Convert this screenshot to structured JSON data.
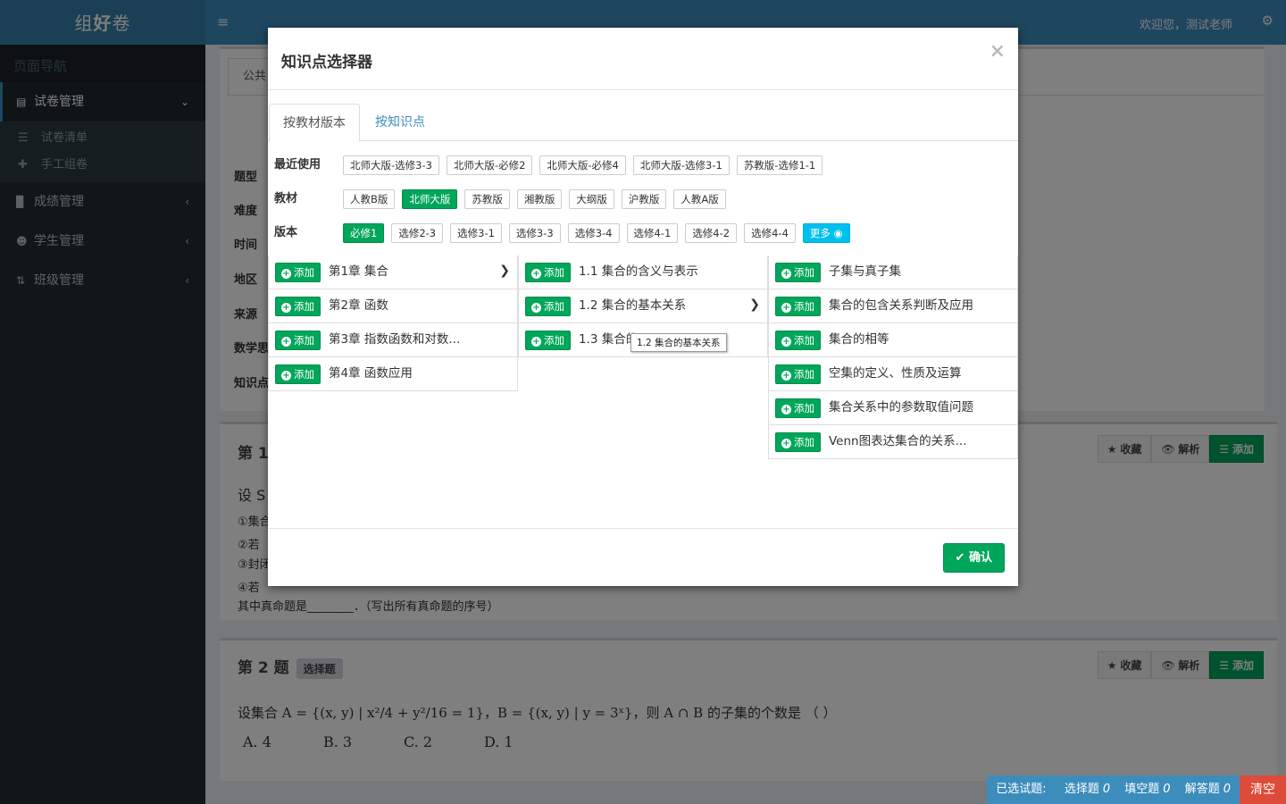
{
  "app": {
    "logo_a": "组",
    "logo_b": "好",
    "logo_c": "卷",
    "welcome": "欢迎您，测试老师"
  },
  "sidebar": {
    "heading": "页面导航",
    "items": [
      {
        "label": "试卷管理",
        "icon": "newspaper-icon",
        "arrow": "⌄"
      },
      {
        "label": "成绩管理",
        "icon": "bar-chart-icon",
        "arrow": "‹"
      },
      {
        "label": "学生管理",
        "icon": "users-icon",
        "arrow": "‹"
      },
      {
        "label": "班级管理",
        "icon": "sort-icon",
        "arrow": "‹"
      }
    ],
    "subitems": [
      {
        "label": "试卷清单",
        "icon": "list-icon"
      },
      {
        "label": "手工组卷",
        "icon": "plus-icon"
      }
    ]
  },
  "background": {
    "tab_label": "公共",
    "form_labels": [
      "题型",
      "难度",
      "时间",
      "地区",
      "来源",
      "数学思",
      "知识点"
    ],
    "q1": {
      "title": "第 1",
      "line1": "设 S",
      "opt1": "①集合",
      "opt2": "②若",
      "opt3": "③封闭",
      "opt4": "④若",
      "tail": "其中真命题是________．（写出所有真命题的序号）"
    },
    "q2": {
      "title": "第 2 题",
      "tag": "选择题",
      "stem": "设集合 A = {(x, y) | x²/4 + y²/16 = 1}，B = {(x, y) | y = 3ˣ}，则 A ∩ B 的子集的个数是 （    ）",
      "choices": [
        "A. 4",
        "B. 3",
        "C. 2",
        "D. 1"
      ]
    },
    "buttons": {
      "fav": "收藏",
      "analysis": "解析",
      "add": "添加"
    }
  },
  "modal": {
    "title": "知识点选择器",
    "close": "×",
    "tabs": [
      "按教材版本",
      "按知识点"
    ],
    "rows": {
      "recent": {
        "label": "最近使用",
        "chips": [
          "北师大版-选修3-3",
          "北师大版-必修2",
          "北师大版-必修4",
          "北师大版-选修3-1",
          "苏教版-选修1-1"
        ]
      },
      "textbook": {
        "label": "教材",
        "chips": [
          "人教B版",
          "北师大版",
          "苏教版",
          "湘教版",
          "大纲版",
          "沪教版",
          "人教A版"
        ],
        "selected": "北师大版"
      },
      "version": {
        "label": "版本",
        "chips": [
          "必修1",
          "选修2-3",
          "选修3-1",
          "选修3-3",
          "选修3-4",
          "选修4-1",
          "选修4-2",
          "选修4-4"
        ],
        "selected": "必修1",
        "more": "更多"
      }
    },
    "add_label": "添加",
    "chapters": [
      "第1章  集合",
      "第2章   函数",
      "第3章   指数函数和对数...",
      "第4章   函数应用"
    ],
    "sections": [
      "1.1 集合的含义与表示",
      "1.2 集合的基本关系",
      "1.3 集合的"
    ],
    "points": [
      "子集与真子集",
      "集合的包含关系判断及应用",
      "集合的相等",
      "空集的定义、性质及运算",
      "集合关系中的参数取值问题",
      "Venn图表达集合的关系..."
    ],
    "tooltip": "1.2 集合的基本关系",
    "confirm": "确认"
  },
  "status": {
    "label": "已选试题:",
    "choice_label": "选择题",
    "choice_count": "0",
    "fill_label": "填空题",
    "fill_count": "0",
    "answer_label": "解答题",
    "answer_count": "0",
    "clear": "清空"
  }
}
